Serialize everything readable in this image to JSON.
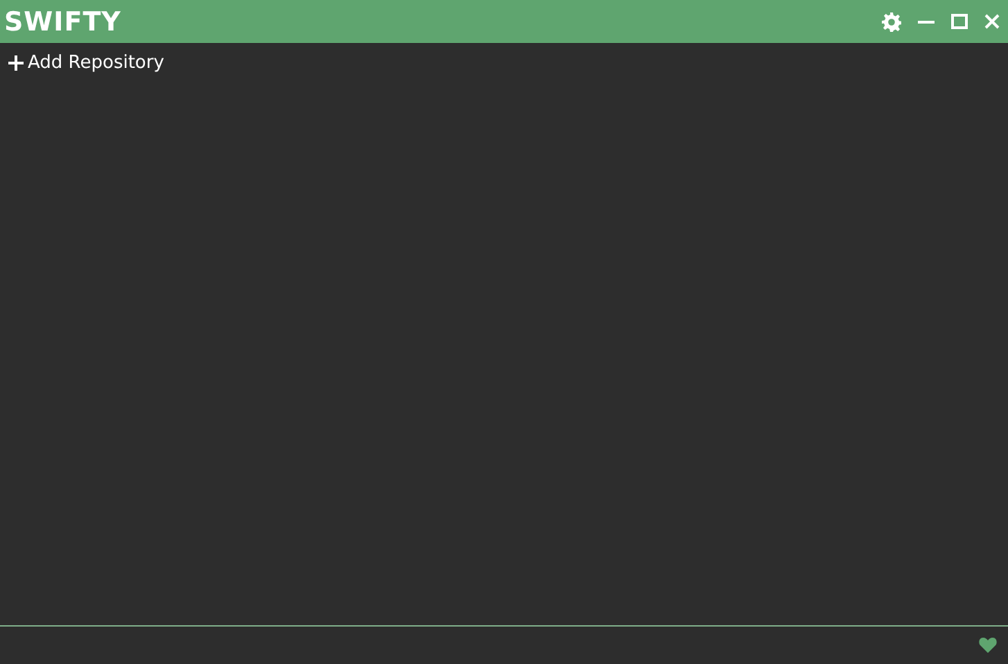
{
  "window": {
    "title": "SWIFTY"
  },
  "toolbar": {
    "add_button": "Add Repository"
  }
}
